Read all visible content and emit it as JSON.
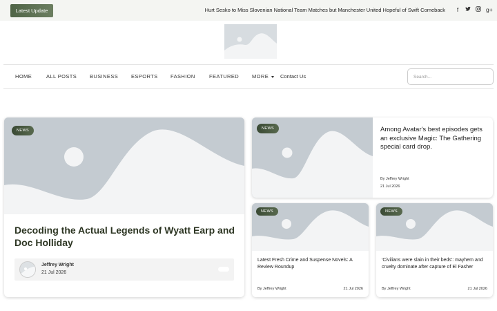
{
  "topbar": {
    "latest_label": "Latest Update",
    "ticker": "Hurt Sesko to Miss Slovenian National Team Matches but Manchester United Hopeful of Swift Comeback",
    "socials": [
      {
        "icon": "facebook-icon",
        "glyph": "f"
      },
      {
        "icon": "twitter-icon",
        "glyph": "🐦"
      },
      {
        "icon": "instagram-icon",
        "glyph": "◙"
      },
      {
        "icon": "google-plus-icon",
        "glyph": "g+"
      }
    ]
  },
  "nav": {
    "items": [
      "HOME",
      "ALL POSTS",
      "BUSINESS",
      "ESPORTS",
      "FASHION",
      "FEATURED",
      "MORE",
      "Contact Us"
    ],
    "search_placeholder": "Search..."
  },
  "featured": {
    "badge": "NEWS",
    "title": "Decoding the Actual Legends of Wyatt Earp and Doc Holliday",
    "author": "Jeffrey Wright",
    "date": "21 Jul 2026"
  },
  "top_right": {
    "badge": "NEWS",
    "title": "Among Avatar's best episodes gets an exclusive Magic: The Gathering special card drop.",
    "author": "By Jeffrey Wright",
    "date": "21 Jul 2026"
  },
  "small_cards": [
    {
      "badge": "NEWS",
      "title": "Latest Fresh Crime and Suspense Novels: A Review Roundup",
      "author": "By Jeffrey Wright",
      "date": "21 Jul 2026"
    },
    {
      "badge": "NEWS",
      "title": "'Civilians were slain in their beds': mayhem and cruelty dominate after capture of El Fasher",
      "author": "By Jeffrey Wright",
      "date": "21 Jul 2026"
    }
  ],
  "colors": {
    "accent": "#4f6446",
    "placeholder": "#c4cbd1",
    "title": "#2c3522"
  }
}
